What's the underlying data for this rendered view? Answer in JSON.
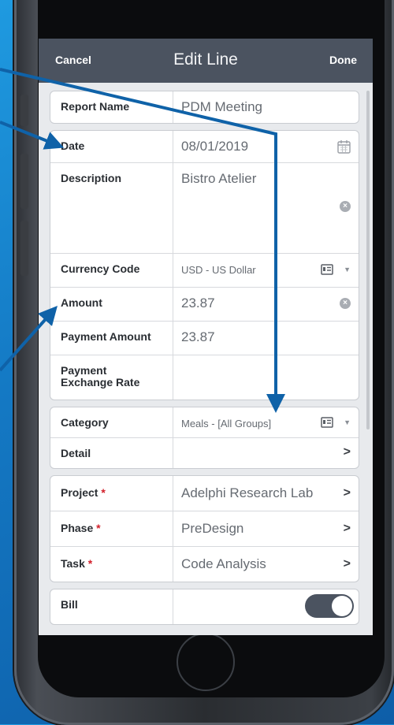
{
  "nav": {
    "cancel": "Cancel",
    "title": "Edit Line",
    "done": "Done"
  },
  "fields": {
    "report_name": {
      "label": "Report Name",
      "value": "PDM Meeting"
    },
    "date": {
      "label": "Date",
      "value": "08/01/2019"
    },
    "description": {
      "label": "Description",
      "value": "Bistro Atelier"
    },
    "currency_code": {
      "label": "Currency Code",
      "value": "USD - US Dollar"
    },
    "amount": {
      "label": "Amount",
      "value": "23.87"
    },
    "payment_amount": {
      "label": "Payment Amount",
      "value": "23.87"
    },
    "payment_exchange_rate": {
      "label": "Payment Exchange Rate",
      "value": ""
    },
    "category": {
      "label": "Category",
      "value": "Meals - [All Groups]"
    },
    "detail": {
      "label": "Detail",
      "value": ""
    },
    "project": {
      "label": "Project",
      "required": "*",
      "value": "Adelphi Research Lab"
    },
    "phase": {
      "label": "Phase",
      "required": "*",
      "value": "PreDesign"
    },
    "task": {
      "label": "Task",
      "required": "*",
      "value": "Code Analysis"
    },
    "billable": {
      "label": "Bill",
      "on": true
    }
  },
  "icons": {
    "calendar": "calendar-icon",
    "clear": "clear-icon",
    "contact_card": "contact-card-icon",
    "chevron": "chevron-right-icon",
    "caret": "caret-down-icon"
  },
  "colors": {
    "accent": "#1479c4",
    "navbar": "#4b5360",
    "required": "#d21f2a",
    "arrow": "#0f62a8"
  }
}
